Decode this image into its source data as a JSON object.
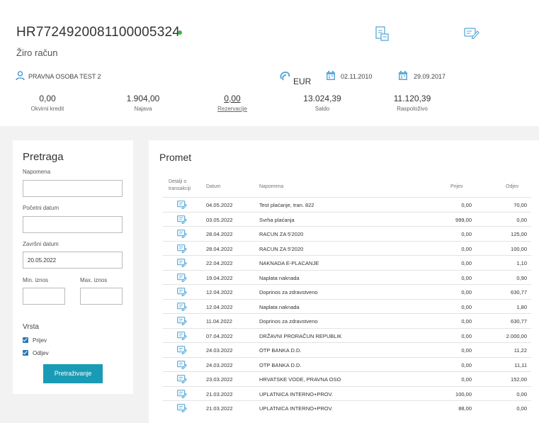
{
  "account": {
    "iban": "HR7724920081100005324",
    "type": "Žiro račun",
    "owner": "PRAVNA OSOBA TEST 2",
    "currency": "EUR",
    "date_from": "02.11.2010",
    "date_to": "29.09.2017"
  },
  "stats": [
    {
      "value": "0,00",
      "label": "Okvirni kredit"
    },
    {
      "value": "1.904,00",
      "label": "Najava"
    },
    {
      "value": "0,00",
      "label": "Rezervacije"
    },
    {
      "value": "13.024,39",
      "label": "Saldo"
    },
    {
      "value": "11.120,39",
      "label": "Raspoloživo"
    }
  ],
  "search": {
    "title": "Pretraga",
    "napomena_label": "Napomena",
    "napomena_value": "",
    "pocetni_label": "Početni datum",
    "pocetni_value": "",
    "zavrsni_label": "Završni datum",
    "zavrsni_value": "20.05.2022",
    "min_label": "Min. iznos",
    "max_label": "Max. iznos",
    "min_value": "",
    "max_value": "",
    "vrsta_label": "Vrsta",
    "prijev_label": "Prijev",
    "odljev_label": "Odljev",
    "button": "Pretraživanje"
  },
  "promet": {
    "title": "Promet",
    "headers": {
      "detalji": "Detalji o transakciji",
      "datum": "Datum",
      "napomena": "Napomena",
      "prijev": "Prijev",
      "odljev": "Odjev"
    },
    "rows": [
      {
        "date": "04.05.2022",
        "desc": "Test plaćanje, tran. 822",
        "in": "0,00",
        "out": "70,00"
      },
      {
        "date": "03.05.2022",
        "desc": "Svrha plaćanja",
        "in": "999,00",
        "out": "0,00"
      },
      {
        "date": "28.04.2022",
        "desc": "RACUN ZA 5'2020",
        "in": "0,00",
        "out": "125,00"
      },
      {
        "date": "28.04.2022",
        "desc": "RACUN ZA 5'2020",
        "in": "0,00",
        "out": "100,00"
      },
      {
        "date": "22.04.2022",
        "desc": "NAKNADA E-PLACANJE",
        "in": "0,00",
        "out": "1,10"
      },
      {
        "date": "19.04.2022",
        "desc": "Naplata naknada",
        "in": "0,00",
        "out": "0,90"
      },
      {
        "date": "12.04.2022",
        "desc": "Doprinos za zdravstveno",
        "in": "0,00",
        "out": "630,77"
      },
      {
        "date": "12.04.2022",
        "desc": "Naplata naknada",
        "in": "0,00",
        "out": "1,80"
      },
      {
        "date": "11.04.2022",
        "desc": "Doprinos za zdravstveno",
        "in": "0,00",
        "out": "630,77"
      },
      {
        "date": "07.04.2022",
        "desc": "DRŽAVNI PRORAČUN REPUBLIK",
        "in": "0,00",
        "out": "2.000,00"
      },
      {
        "date": "24.03.2022",
        "desc": "OTP BANKA D.D.",
        "in": "0,00",
        "out": "11,22"
      },
      {
        "date": "24.03.2022",
        "desc": "OTP BANKA D.D.",
        "in": "0,00",
        "out": "11,11"
      },
      {
        "date": "23.03.2022",
        "desc": "HRVATSKE VODE, PRAVNA OSO",
        "in": "0,00",
        "out": "152,00"
      },
      {
        "date": "21.03.2022",
        "desc": "UPLATNICA INTERNO+PROV.",
        "in": "100,00",
        "out": "0,00"
      },
      {
        "date": "21.03.2022",
        "desc": "UPLATNICA INTERNO+PROV.",
        "in": "88,00",
        "out": "0,00"
      }
    ]
  },
  "icons": {
    "report": "document-report-icon",
    "edit": "edit-card-icon",
    "owner": "user-icon",
    "currency": "currency-icon",
    "calendar": "calendar-icon",
    "details": "transaction-details-icon"
  },
  "colors": {
    "accent": "#1a9bb5",
    "status_dot": "#3cb44b",
    "checkbox": "#2a7ab8"
  }
}
